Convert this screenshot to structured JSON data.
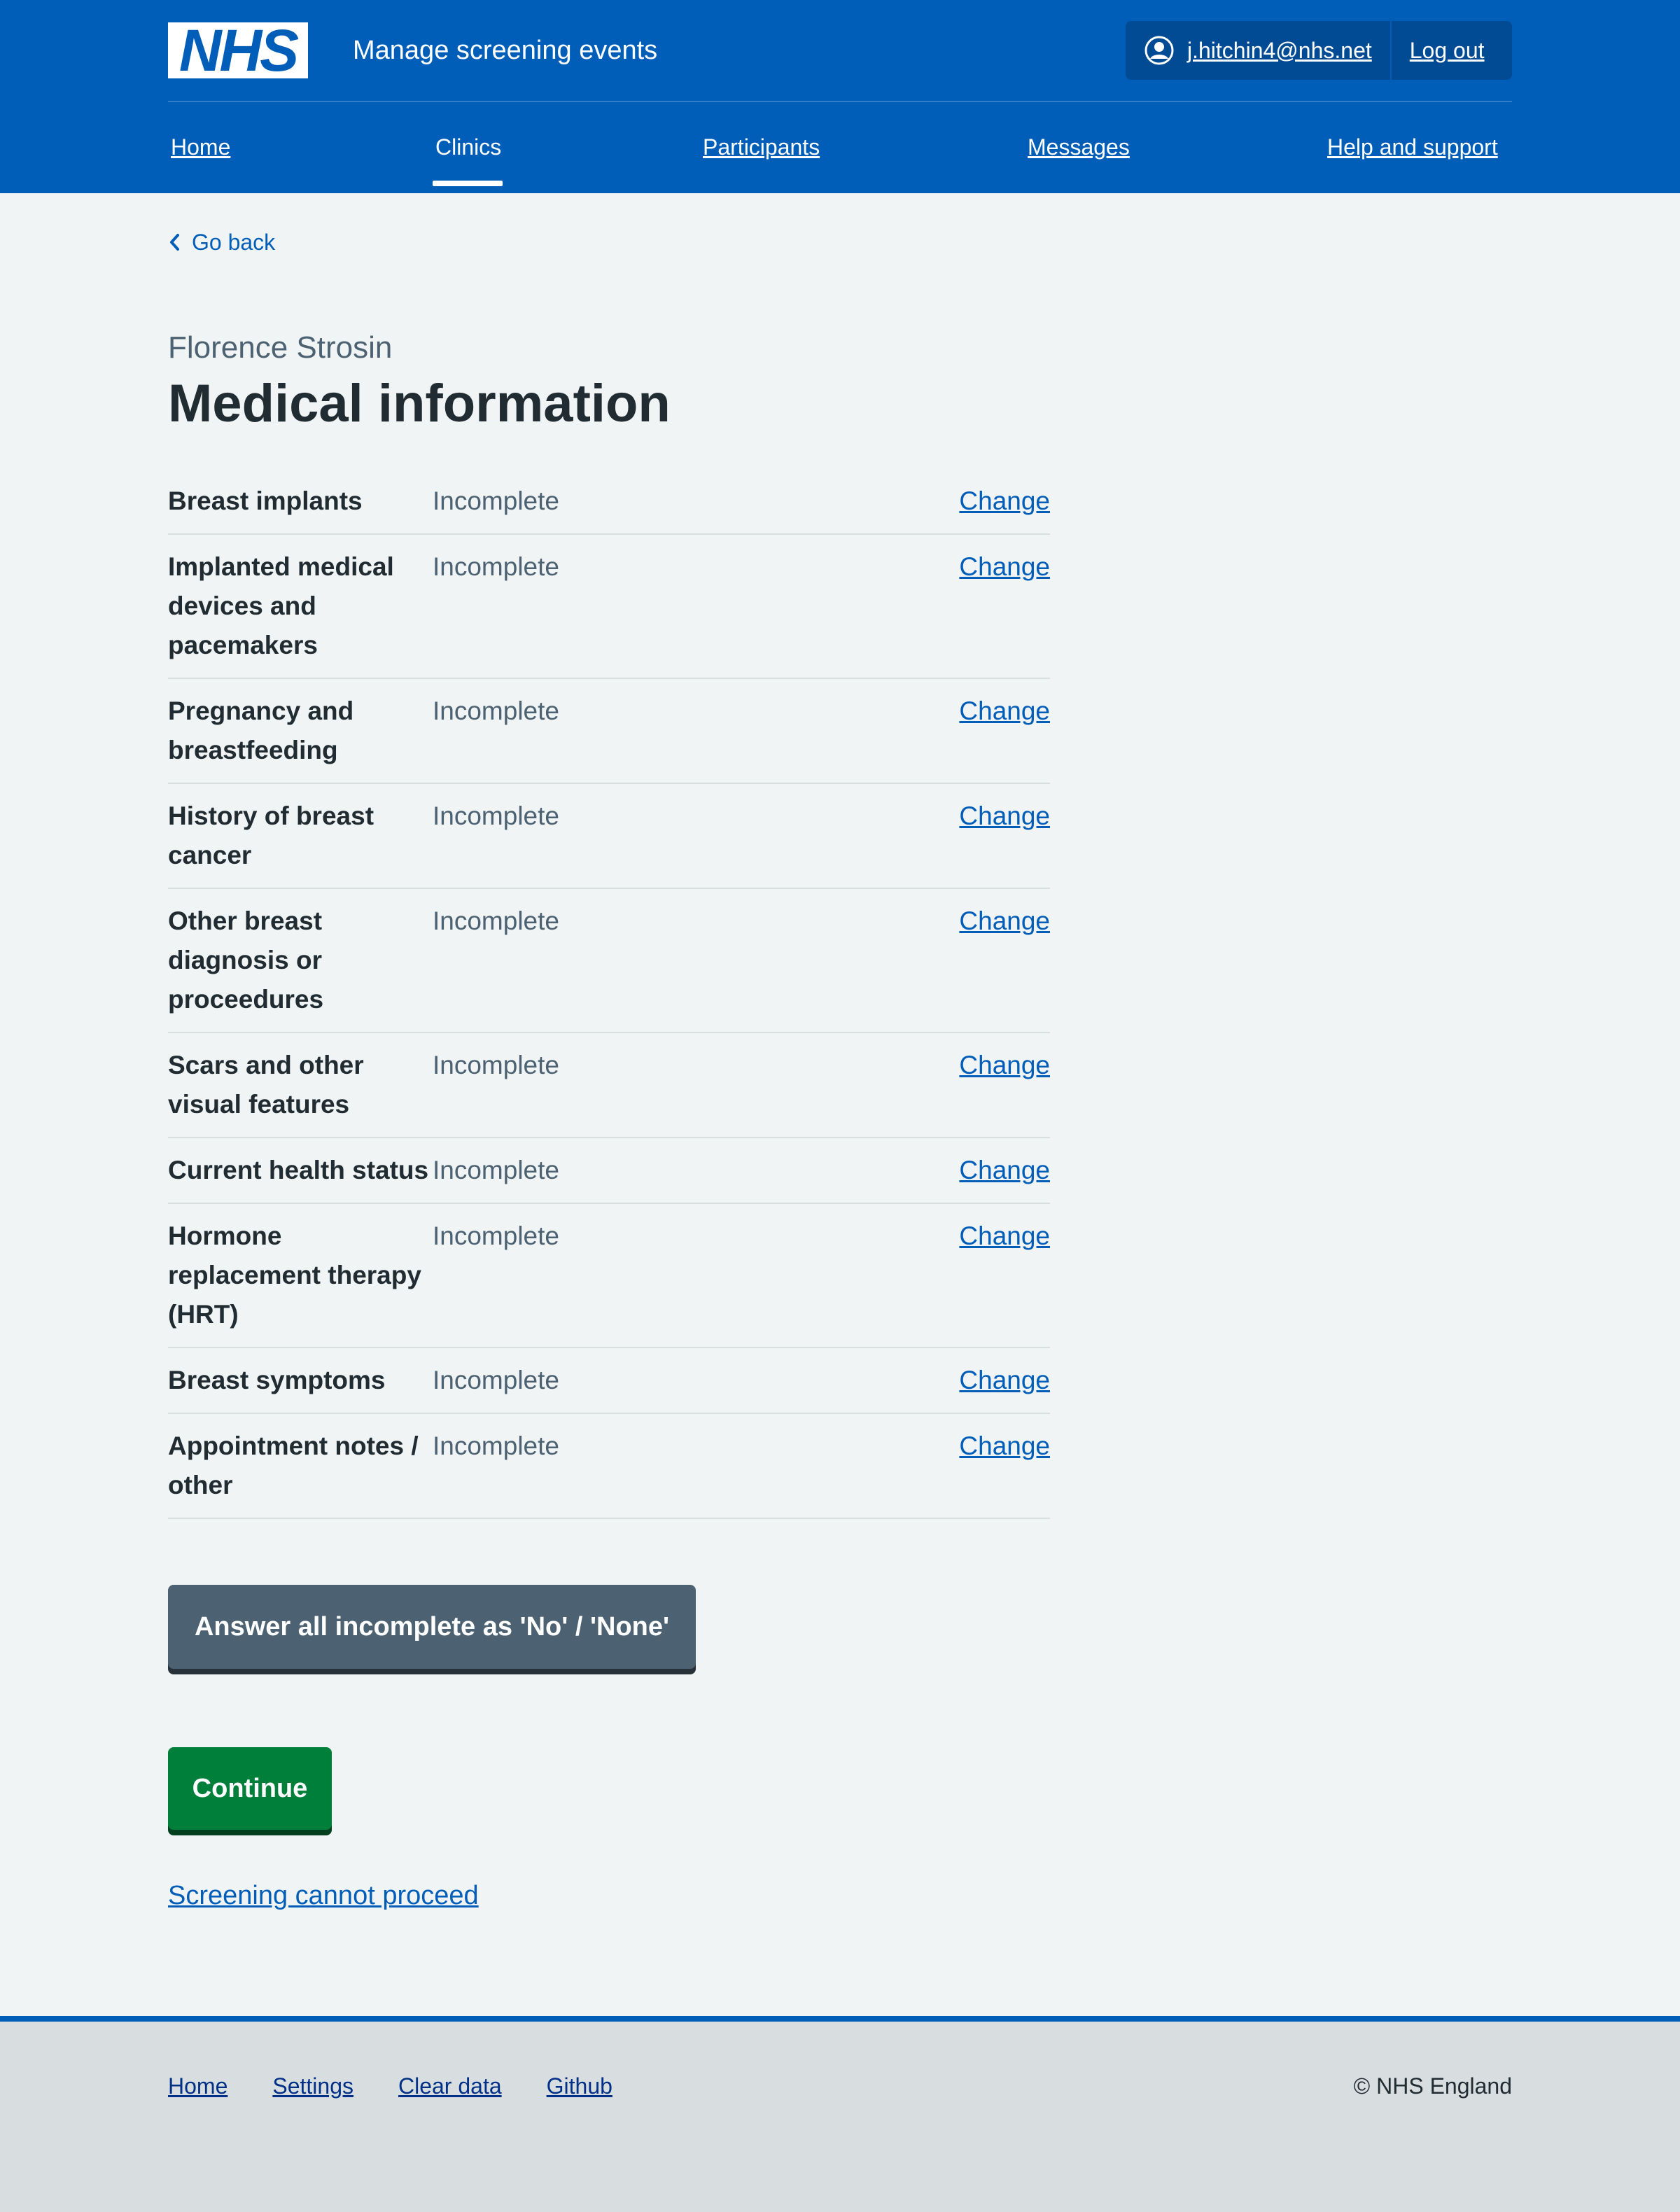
{
  "header": {
    "logo_text": "NHS",
    "service_name": "Manage screening events",
    "user_email": "j.hitchin4@nhs.net",
    "logout_label": "Log out",
    "nav": [
      {
        "label": "Home"
      },
      {
        "label": "Clinics",
        "active": true
      },
      {
        "label": "Participants"
      },
      {
        "label": "Messages"
      },
      {
        "label": "Help and support"
      }
    ]
  },
  "back_link": "Go back",
  "caption": "Florence Strosin",
  "title": "Medical information",
  "summary": [
    {
      "key": "Breast implants",
      "value": "Incomplete",
      "action": "Change"
    },
    {
      "key": "Implanted medical devices and pacemakers",
      "value": "Incomplete",
      "action": "Change"
    },
    {
      "key": "Pregnancy and breastfeeding",
      "value": "Incomplete",
      "action": "Change"
    },
    {
      "key": "History of breast cancer",
      "value": "Incomplete",
      "action": "Change"
    },
    {
      "key": "Other breast diagnosis or proceedures",
      "value": "Incomplete",
      "action": "Change"
    },
    {
      "key": "Scars and other visual features",
      "value": "Incomplete",
      "action": "Change"
    },
    {
      "key": "Current health status",
      "value": "Incomplete",
      "action": "Change"
    },
    {
      "key": "Hormone replacement therapy (HRT)",
      "value": "Incomplete",
      "action": "Change"
    },
    {
      "key": "Breast symptoms",
      "value": "Incomplete",
      "action": "Change"
    },
    {
      "key": "Appointment notes / other",
      "value": "Incomplete",
      "action": "Change"
    }
  ],
  "buttons": {
    "answer_all": "Answer all incomplete as 'No' / 'None'",
    "continue": "Continue"
  },
  "cannot_proceed_link": "Screening cannot proceed",
  "footer": {
    "links": [
      "Home",
      "Settings",
      "Clear data",
      "Github"
    ],
    "copyright": "© NHS England"
  },
  "colors": {
    "nhs_blue": "#005eb8",
    "green": "#007f3b",
    "secondary_grey": "#4c6272"
  }
}
